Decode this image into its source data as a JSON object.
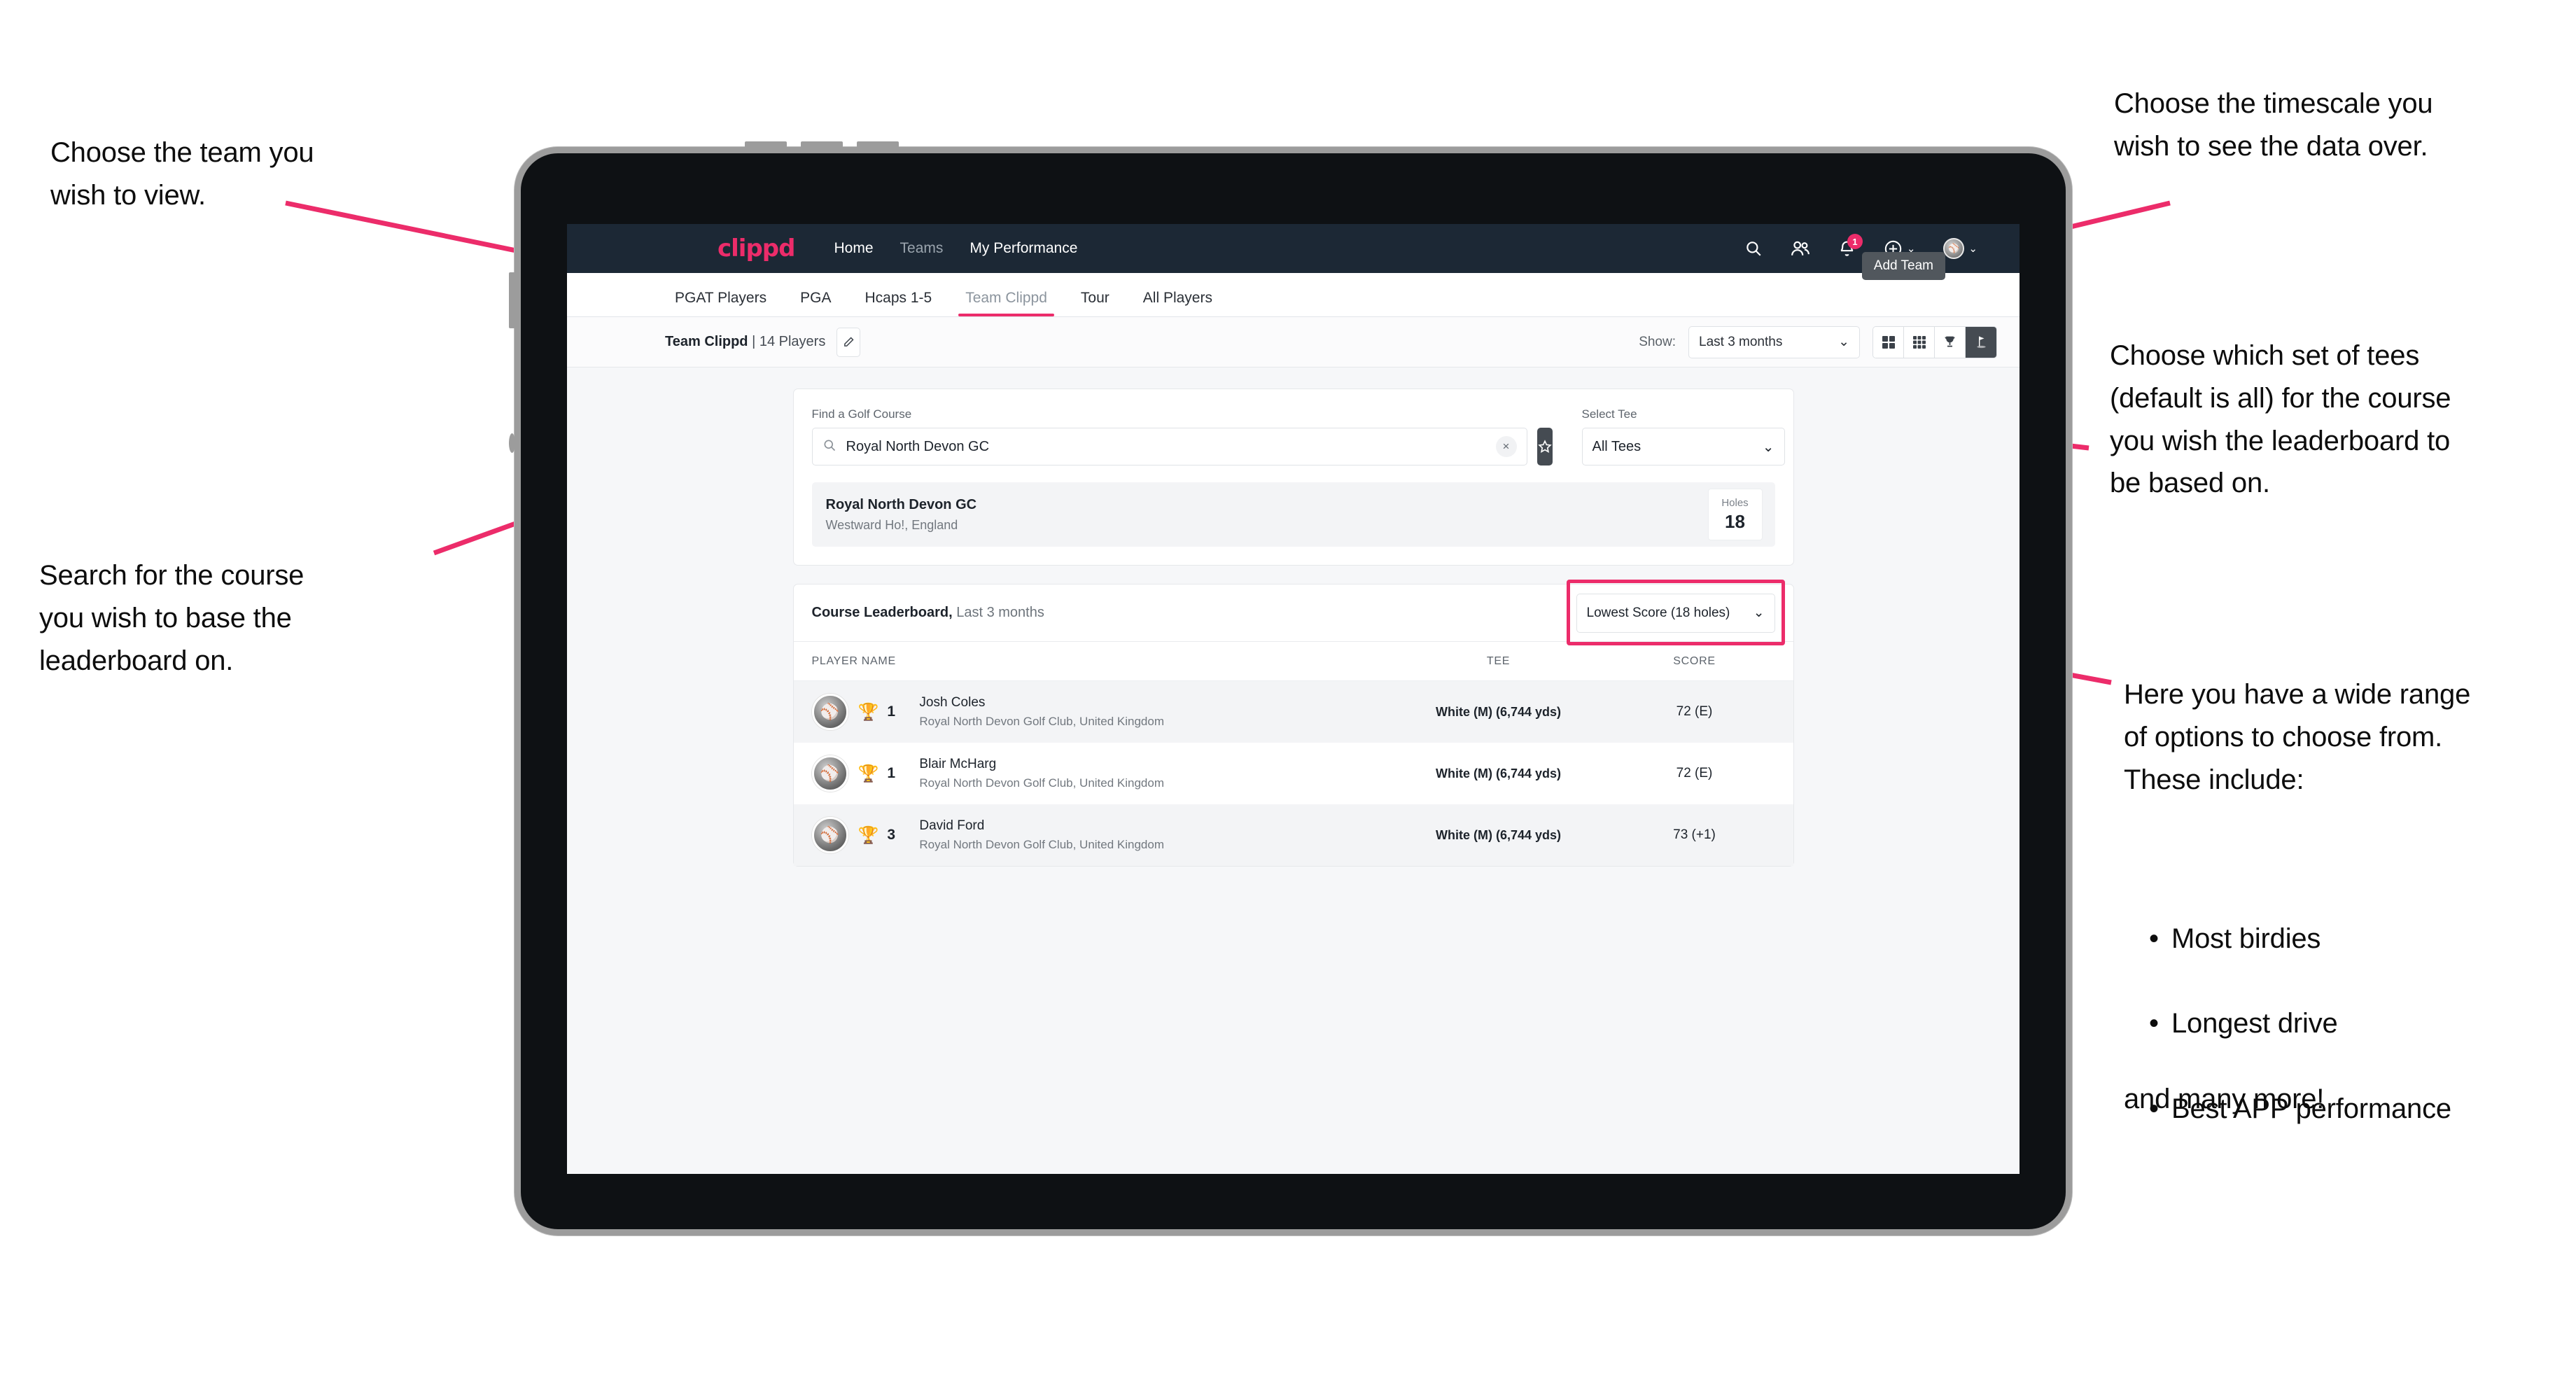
{
  "annotations": {
    "team": "Choose the team you\nwish to view.",
    "timescale": "Choose the timescale you\nwish to see the data over.",
    "tees": "Choose which set of tees\n(default is all) for the course\nyou wish the leaderboard to\nbe based on.",
    "search": "Search for the course\nyou wish to base the\nleaderboard on.",
    "options_intro": "Here you have a wide range\nof options to choose from.\nThese include:",
    "options_list": [
      "Most birdies",
      "Longest drive",
      "Best APP performance"
    ],
    "options_outro": "and many more!"
  },
  "navbar": {
    "brand": "clippd",
    "links": [
      {
        "label": "Home",
        "active": true
      },
      {
        "label": "Teams",
        "active": false
      },
      {
        "label": "My Performance",
        "active": true
      }
    ],
    "icons": {
      "search": "search-icon",
      "people": "people-icon",
      "bell": "bell-icon",
      "plus": "plus-circle-icon",
      "avatar": "avatar-icon"
    },
    "notification_count": "1",
    "caret": "⌄"
  },
  "tabs": {
    "items": [
      {
        "label": "PGAT Players",
        "active": false,
        "dim": false
      },
      {
        "label": "PGA",
        "active": false,
        "dim": false
      },
      {
        "label": "Hcaps 1-5",
        "active": false,
        "dim": false
      },
      {
        "label": "Team Clippd",
        "active": true,
        "dim": true
      },
      {
        "label": "Tour",
        "active": false,
        "dim": false
      },
      {
        "label": "All Players",
        "active": false,
        "dim": false
      }
    ],
    "tooltip": "Add Team"
  },
  "subbar": {
    "team_name": "Team Clippd",
    "team_count": " | 14 Players",
    "edit_icon": "pencil-icon",
    "show_label": "Show:",
    "period_value": "Last 3 months",
    "period_caret": "⌄",
    "views": [
      {
        "name": "grid-4-view",
        "active": false
      },
      {
        "name": "grid-9-view",
        "active": false
      },
      {
        "name": "trophy-view",
        "active": false
      },
      {
        "name": "course-flag-view",
        "active": true
      }
    ]
  },
  "search_panel": {
    "course_label": "Find a Golf Course",
    "course_value": "Royal North Devon GC",
    "course_placeholder": "Find a Golf Course",
    "clear_icon": "×",
    "star_icon": "star-icon",
    "tee_label": "Select Tee",
    "tee_value": "All Tees",
    "tee_caret": "⌄"
  },
  "course_result": {
    "name": "Royal North Devon GC",
    "location": "Westward Ho!, England",
    "holes_label": "Holes",
    "holes_value": "18"
  },
  "leaderboard": {
    "title": "Course Leaderboard,",
    "subtitle": " Last 3 months",
    "metric_value": "Lowest Score (18 holes)",
    "metric_caret": "⌄",
    "columns": [
      "PLAYER NAME",
      "TEE",
      "SCORE"
    ],
    "rows": [
      {
        "rank": "1",
        "name": "Josh Coles",
        "club": "Royal North Devon Golf Club, United Kingdom",
        "tee": "White (M) (6,744 yds)",
        "score": "72 (E)"
      },
      {
        "rank": "1",
        "name": "Blair McHarg",
        "club": "Royal North Devon Golf Club, United Kingdom",
        "tee": "White (M) (6,744 yds)",
        "score": "72 (E)"
      },
      {
        "rank": "3",
        "name": "David Ford",
        "club": "Royal North Devon Golf Club, United Kingdom",
        "tee": "White (M) (6,744 yds)",
        "score": "73 (+1)"
      }
    ]
  },
  "colors": {
    "accent": "#ec2c6a",
    "navbar": "#1c2835",
    "page_bg": "#f6f7f9",
    "dark_button": "#454b52"
  }
}
